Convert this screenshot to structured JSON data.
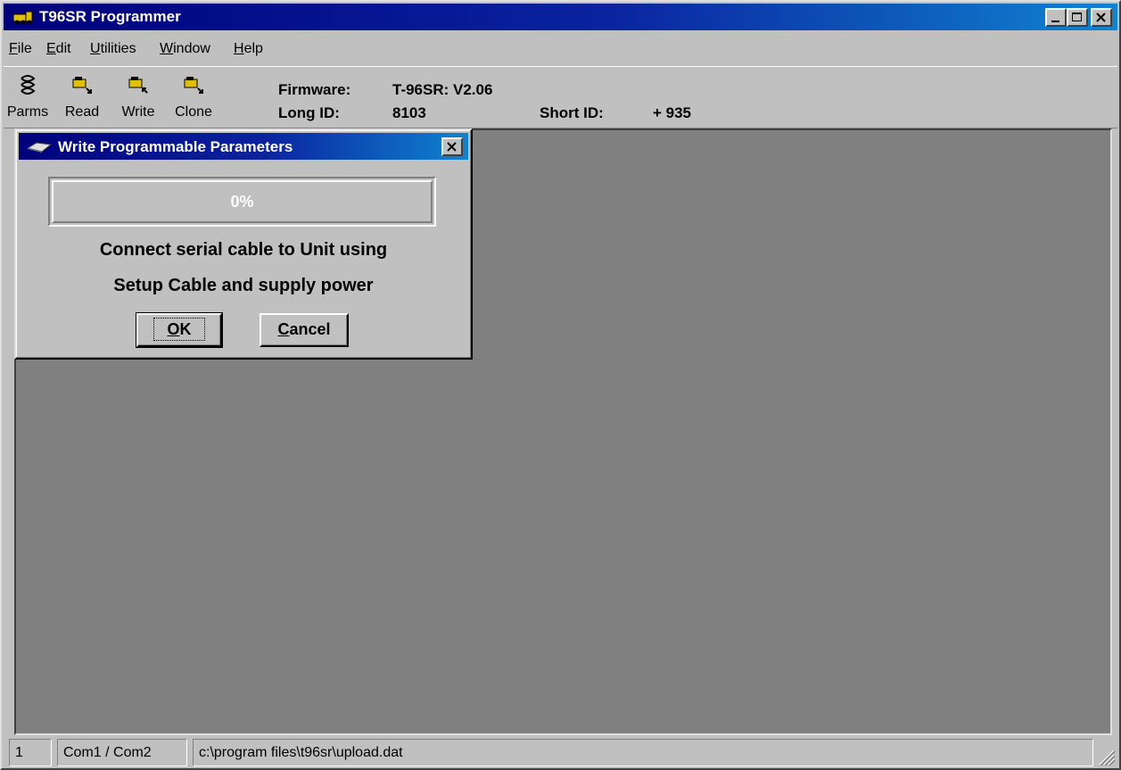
{
  "window": {
    "title": "T96SR Programmer",
    "minimize_label": "_",
    "maximize_label": "□",
    "close_label": "×"
  },
  "menu": {
    "items": [
      {
        "accel": "F",
        "rest": "ile"
      },
      {
        "accel": "E",
        "rest": "dit"
      },
      {
        "accel": "U",
        "rest": "tilities"
      },
      {
        "accel": "W",
        "rest": "indow"
      },
      {
        "accel": "H",
        "rest": "elp"
      }
    ]
  },
  "toolbar": {
    "buttons": [
      {
        "label": "Parms",
        "icon": "parameters-icon"
      },
      {
        "label": "Read",
        "icon": "read-device-icon"
      },
      {
        "label": "Write",
        "icon": "write-device-icon"
      },
      {
        "label": "Clone",
        "icon": "clone-device-icon"
      }
    ],
    "firmware_label": "Firmware:",
    "firmware_value": "T-96SR: V2.06",
    "long_id_label": "Long ID:",
    "long_id_value": "8103",
    "short_id_label": "Short ID:",
    "short_id_value": "+ 935"
  },
  "dialog": {
    "title": "Write Programmable Parameters",
    "progress_percent": 0,
    "progress_text": "0%",
    "message_line1": "Connect serial cable to Unit using",
    "message_line2": "Setup Cable and supply power",
    "ok_accel": "O",
    "ok_rest": "K",
    "cancel_accel": "C",
    "cancel_rest": "ancel"
  },
  "statusbar": {
    "pane1": "1",
    "pane2": "Com1 / Com2",
    "pane3": "c:\\program files\\t96sr\\upload.dat"
  },
  "colors": {
    "titlebar_start": "#00007b",
    "titlebar_end": "#1084d0",
    "face": "#c0c0c0",
    "mdi_background": "#808080"
  }
}
